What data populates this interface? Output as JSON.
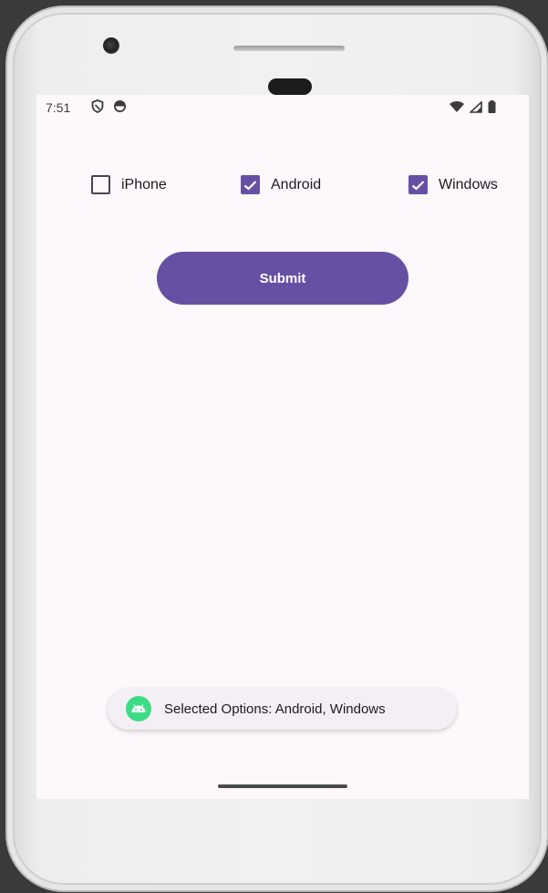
{
  "status_bar": {
    "time": "7:51"
  },
  "options": [
    {
      "label": "iPhone",
      "checked": false
    },
    {
      "label": "Android",
      "checked": true
    },
    {
      "label": "Windows",
      "checked": true
    }
  ],
  "submit": {
    "label": "Submit"
  },
  "toast": {
    "text": "Selected Options: Android, Windows"
  },
  "colors": {
    "accent": "#6750a4",
    "screen_bg": "#fdf8fc",
    "toast_icon": "#3ddc84"
  },
  "icons": {
    "status_left": [
      "vpn-shield-icon",
      "data-saver-icon"
    ],
    "status_right": [
      "wifi-icon",
      "cell-signal-icon",
      "battery-icon"
    ],
    "toast": "android-app-icon"
  }
}
